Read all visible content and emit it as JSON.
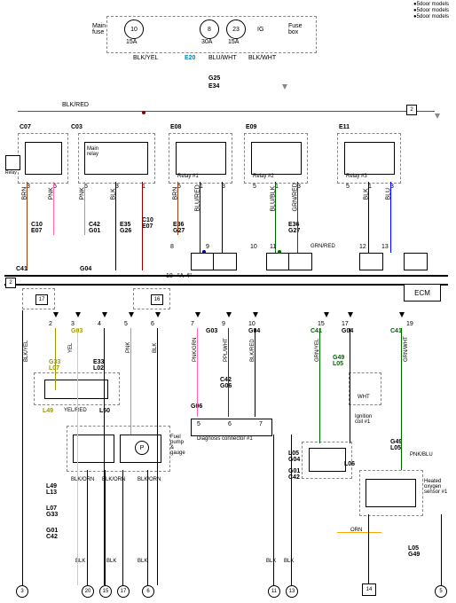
{
  "corner": {
    "line1": "●5door models",
    "line2": "●5door models",
    "line3": "●5door models"
  },
  "top": {
    "main_fuse": "Main\nfuse",
    "ig": "IG",
    "fuse_box": "Fuse\nbox",
    "fuse10_num": "10",
    "fuse10_amp": "15A",
    "fuse8_num": "8",
    "fuse8_amp": "30A",
    "fuse23_num": "23",
    "fuse23_amp": "15A",
    "e20": "E20",
    "g25": "G25",
    "e34": "E34",
    "blk_yel": "BLK/YEL",
    "blu_wht": "BLU/WHT",
    "blk_wht": "BLK/WHT",
    "blk_red": "BLK/RED"
  },
  "relays": {
    "c07": "C07",
    "c03": "C03",
    "e08": "E08",
    "e09": "E09",
    "e11": "E11",
    "relay_label": "Relay",
    "main_relay": "Main\nrelay",
    "relay1": "Relay #1",
    "relay2": "Relay #2",
    "relay3": "Relay #3",
    "num1": "1",
    "num2": "2",
    "num3": "3",
    "num4": "4",
    "num5": "5"
  },
  "wires": {
    "brn": "BRN",
    "pnk": "PNK",
    "blk": "BLK",
    "blu": "BLU",
    "blu_red": "BLU/RED",
    "blu_blk": "BLU/BLK",
    "grn_red": "GRN/RED",
    "blk_red": "BLK/RED",
    "blk_yel": "BLK/YEL",
    "yel_red": "YEL/RED",
    "blk_orn": "BLK/ORN",
    "pnk_blu": "PNK/BLU",
    "grn_yel": "GRN/YEL",
    "grn_wht": "GRN/WHT",
    "ppl_wht": "PPL/WHT",
    "pnk_grn": "PNK/GRN",
    "orn": "ORN",
    "wht": "WHT"
  },
  "connectors": {
    "c10_e07": "C10\nE07",
    "c42_g01": "C42\nG01",
    "e35_g26": "E35\nG26",
    "c10_e07_2": "C10\nE07",
    "e36_g27": "E36\nG27",
    "e36_g27_2": "E36\nG27",
    "c41": "C41",
    "g04": "G04",
    "g03": "G03",
    "g33_l07": "G33\nL07",
    "e33_l02": "E33\nL02",
    "l49": "L49",
    "l50": "L50",
    "l49_l13": "L49\nL13",
    "l07_g33": "L07\nG33",
    "g01_c42": "G01\nC42",
    "c42_g06": "C42\nG06",
    "g06": "G06",
    "g03_c": "G03",
    "g04_c": "G04",
    "g49_l05": "G49\nL05",
    "l05_g04": "L05\nG04",
    "g01_c42_2": "G01\nC42",
    "g49_l05_2": "G49\nL05",
    "l05_g49": "L05\nG49",
    "l06": "L06"
  },
  "mid": {
    "ecm": "ECM",
    "a4": "\"A-4\"",
    "num17": "17",
    "num16": "16",
    "num18": "18",
    "num14": "14",
    "num8": "8",
    "num11": "11",
    "num12": "12",
    "num13": "13",
    "num15": "15",
    "num17_b": "17",
    "num19": "19",
    "num2": "2",
    "num3": "3",
    "num4": "4",
    "num5": "5",
    "num6": "6",
    "num7": "7",
    "num9": "9",
    "num10": "10"
  },
  "lower": {
    "fuel_pump": "Fuel\npump\n&\ngauge",
    "diagnosis": "Diagnosis connector #1",
    "ignition_coil": "Ignition\ncoil #1",
    "heated_o2": "Heated\noxygen\nsensor #1",
    "p_label": "P"
  },
  "grounds": {
    "g3": "3",
    "g20": "20",
    "g15": "15",
    "g17": "17",
    "g6": "6",
    "g11": "11",
    "g13": "13",
    "g14": "14",
    "g5": "5"
  }
}
